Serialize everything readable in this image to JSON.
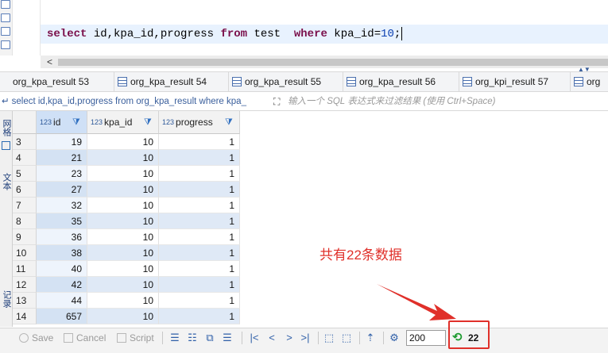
{
  "editor": {
    "sql": {
      "k1": "select",
      "t1": " id,kpa_id,progress ",
      "k2": "from",
      "t2": " test  ",
      "k3": "where",
      "t3": " kpa_id=",
      "n1": "10",
      "t4": ";"
    }
  },
  "scroll": {
    "left_arrow": "<",
    "spin": "▲▼"
  },
  "tabs": [
    {
      "label": "org_kpa_result 53"
    },
    {
      "label": "org_kpa_result 54"
    },
    {
      "label": "org_kpa_result 55"
    },
    {
      "label": "org_kpa_result 56"
    },
    {
      "label": "org_kpi_result 57"
    },
    {
      "label": "org"
    }
  ],
  "filter": {
    "sql_text": "select id,kpa_id,progress from org_kpa_result where kpa_",
    "placeholder": "输入一个 SQL 表达式来过滤结果 (使用 Ctrl+Space)"
  },
  "side_panel": {
    "grid_label": "网格",
    "text_label": "文本",
    "record_label": "记录"
  },
  "columns": [
    {
      "type": "123",
      "name": "id"
    },
    {
      "type": "123",
      "name": "kpa_id"
    },
    {
      "type": "123",
      "name": "progress"
    }
  ],
  "rows": [
    {
      "n": "3",
      "id": "19",
      "kpa_id": "10",
      "progress": "1"
    },
    {
      "n": "4",
      "id": "21",
      "kpa_id": "10",
      "progress": "1"
    },
    {
      "n": "5",
      "id": "23",
      "kpa_id": "10",
      "progress": "1"
    },
    {
      "n": "6",
      "id": "27",
      "kpa_id": "10",
      "progress": "1"
    },
    {
      "n": "7",
      "id": "32",
      "kpa_id": "10",
      "progress": "1"
    },
    {
      "n": "8",
      "id": "35",
      "kpa_id": "10",
      "progress": "1"
    },
    {
      "n": "9",
      "id": "36",
      "kpa_id": "10",
      "progress": "1"
    },
    {
      "n": "10",
      "id": "38",
      "kpa_id": "10",
      "progress": "1"
    },
    {
      "n": "11",
      "id": "40",
      "kpa_id": "10",
      "progress": "1"
    },
    {
      "n": "12",
      "id": "42",
      "kpa_id": "10",
      "progress": "1"
    },
    {
      "n": "13",
      "id": "44",
      "kpa_id": "10",
      "progress": "1"
    },
    {
      "n": "14",
      "id": "657",
      "kpa_id": "10",
      "progress": "1"
    }
  ],
  "annotation": {
    "text": "共有22条数据",
    "color": "#e0302a"
  },
  "toolbar": {
    "save": "Save",
    "cancel": "Cancel",
    "script": "Script",
    "fetch_size": "200",
    "row_count": "22"
  }
}
